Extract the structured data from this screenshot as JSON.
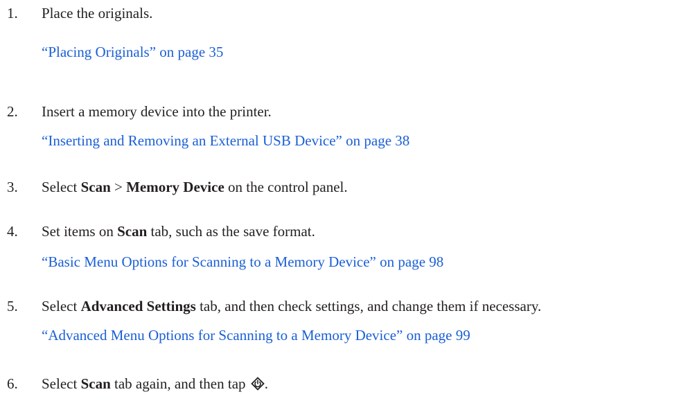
{
  "steps": [
    {
      "number": "1.",
      "text_parts": [
        "Place the originals."
      ],
      "link": "“Placing Originals” on page 35"
    },
    {
      "number": "2.",
      "text_parts": [
        "Insert a memory device into the printer."
      ],
      "link": "“Inserting and Removing an External USB Device” on page 38"
    },
    {
      "number": "3.",
      "text_parts": [
        "Select ",
        "Scan",
        " > ",
        "Memory Device",
        " on the control panel."
      ]
    },
    {
      "number": "4.",
      "text_parts": [
        "Set items on ",
        "Scan",
        " tab, such as the save format."
      ],
      "link": "“Basic Menu Options for Scanning to a Memory Device” on page 98"
    },
    {
      "number": "5.",
      "text_parts": [
        "Select ",
        "Advanced Settings",
        " tab, and then check settings, and change them if necessary."
      ],
      "link": "“Advanced Menu Options for Scanning to a Memory Device” on page 99"
    },
    {
      "number": "6.",
      "text_parts": [
        "Select ",
        "Scan",
        " tab again, and then tap ",
        "."
      ],
      "icon": "start-button-icon"
    }
  ],
  "colors": {
    "text": "#231f20",
    "link": "#1a5fd6"
  }
}
